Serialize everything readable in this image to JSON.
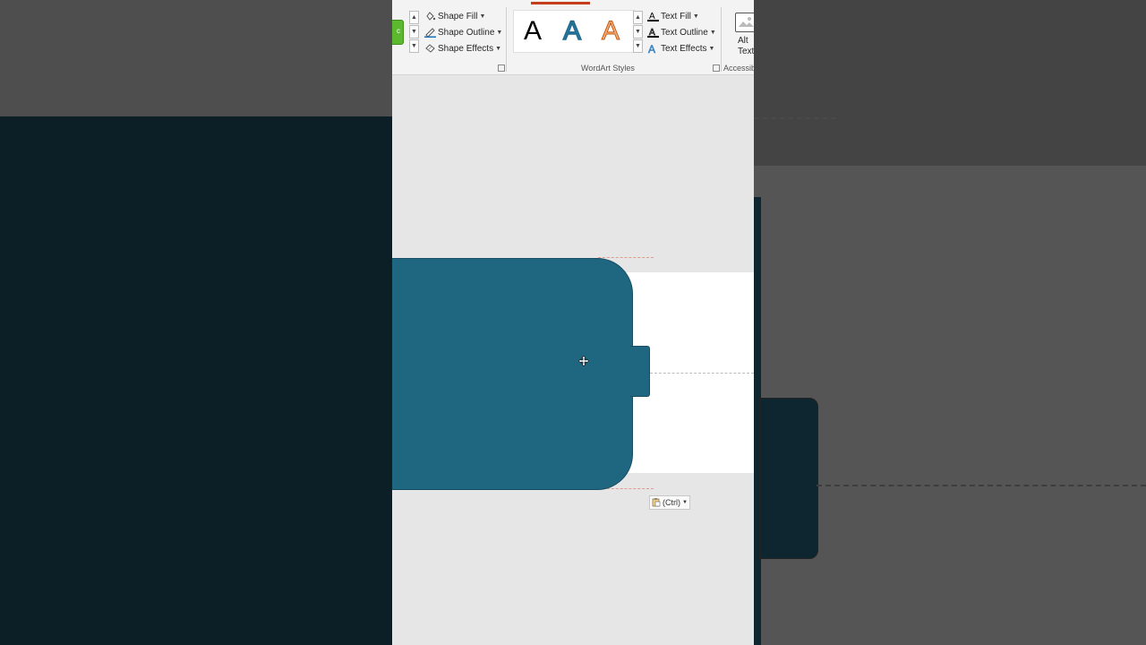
{
  "ribbon": {
    "shape_styles": {
      "shape_fill": "Shape Fill",
      "shape_outline": "Shape Outline",
      "shape_effects": "Shape Effects"
    },
    "wordart": {
      "group_label": "WordArt Styles",
      "samples": [
        "A",
        "A",
        "A"
      ],
      "text_fill": "Text Fill",
      "text_outline": "Text Outline",
      "text_effects": "Text Effects"
    },
    "accessibility": {
      "alt_text_line1": "Alt",
      "alt_text_line2": "Text",
      "group_label": "Accessibi"
    },
    "green_button_text": "c"
  },
  "canvas": {
    "paste_options_label": "(Ctrl)",
    "shape_fill_color": "#1f6680"
  },
  "colors": {
    "accent_tab": "#c43e1c",
    "shape": "#1f6680",
    "green": "#5cb82e"
  }
}
